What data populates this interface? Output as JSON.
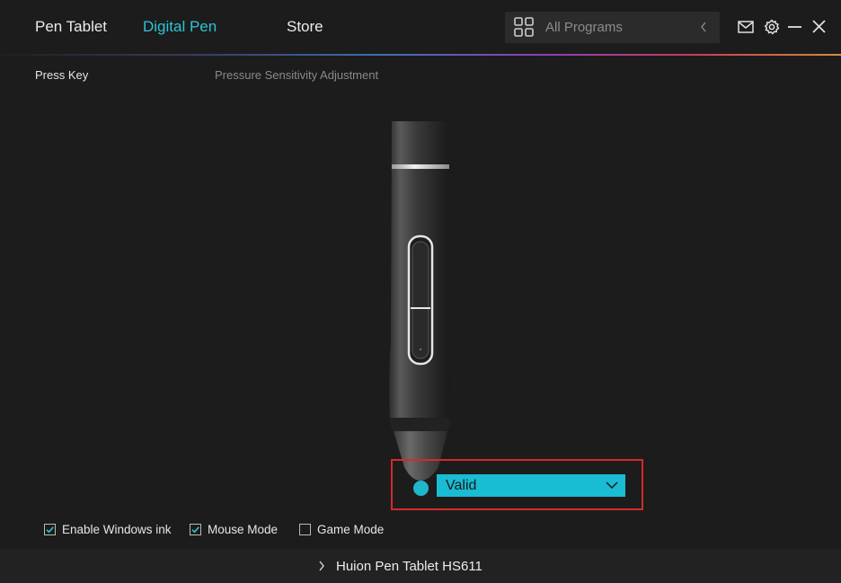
{
  "nav": {
    "tabs": [
      {
        "label": "Pen Tablet",
        "active": false
      },
      {
        "label": "Digital Pen",
        "active": true
      },
      {
        "label": "Store",
        "active": false
      }
    ]
  },
  "program_selector": {
    "label": "All Programs",
    "icon": "grid-icon"
  },
  "window_controls": [
    "mail-icon",
    "gear-icon",
    "minimize-icon",
    "close-icon"
  ],
  "sub_tabs": [
    {
      "label": "Press Key",
      "active": true
    },
    {
      "label": "Pressure Sensitivity Adjustment",
      "active": false
    }
  ],
  "pen_tip_setting": {
    "selected_value": "Valid"
  },
  "options": [
    {
      "label": "Enable Windows ink",
      "checked": true
    },
    {
      "label": "Mouse Mode",
      "checked": true
    },
    {
      "label": "Game Mode",
      "checked": false
    }
  ],
  "device": {
    "name": "Huion Pen Tablet HS611"
  },
  "colors": {
    "accent": "#19bcd3",
    "background": "#1c1c1c",
    "highlight": "#d42a2a"
  }
}
